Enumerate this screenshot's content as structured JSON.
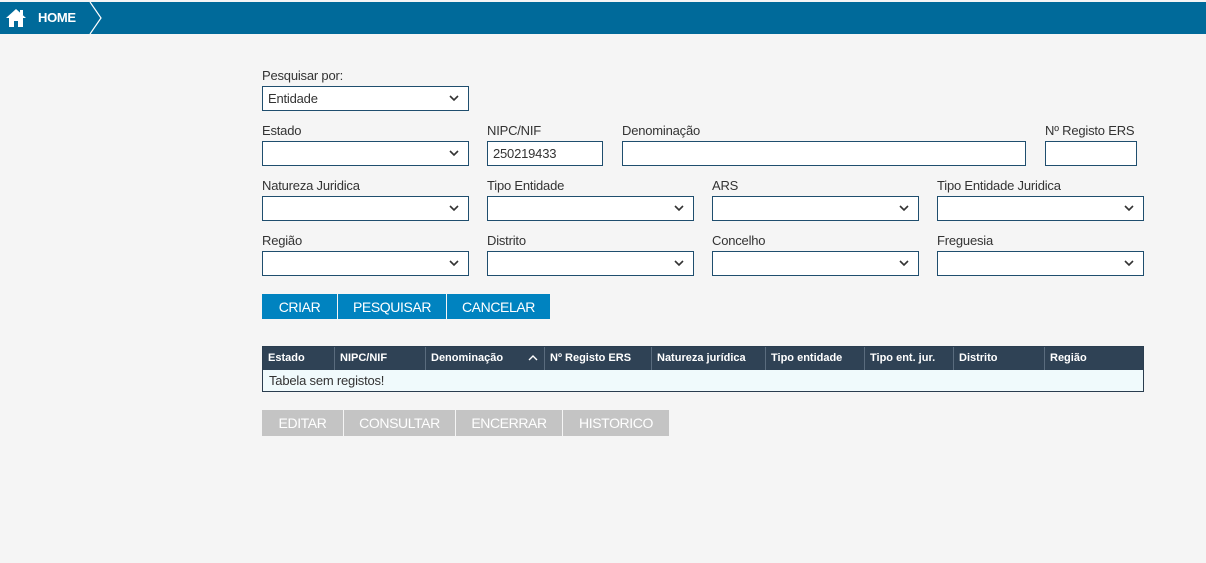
{
  "header": {
    "home_label": "HOME"
  },
  "search": {
    "label": "Pesquisar por:",
    "selected": "Entidade"
  },
  "fields": {
    "estado": {
      "label": "Estado",
      "value": ""
    },
    "nipc": {
      "label": "NIPC/NIF",
      "value": "250219433"
    },
    "denominacao": {
      "label": "Denominação",
      "value": ""
    },
    "registo_ers": {
      "label": "Nº Registo ERS",
      "value": ""
    },
    "natureza": {
      "label": "Natureza Juridica",
      "value": ""
    },
    "tipo_entidade": {
      "label": "Tipo Entidade",
      "value": ""
    },
    "ars": {
      "label": "ARS",
      "value": ""
    },
    "tipo_entidade_juridica": {
      "label": "Tipo Entidade Juridica",
      "value": ""
    },
    "regiao": {
      "label": "Região",
      "value": ""
    },
    "distrito": {
      "label": "Distrito",
      "value": ""
    },
    "concelho": {
      "label": "Concelho",
      "value": ""
    },
    "freguesia": {
      "label": "Freguesia",
      "value": ""
    }
  },
  "actions": {
    "criar": "CRIAR",
    "pesquisar": "PESQUISAR",
    "cancelar": "CANCELAR"
  },
  "table": {
    "columns": [
      "Estado",
      "NIPC/NIF",
      "Denominação",
      "Nº Registo ERS",
      "Natureza jurídica",
      "Tipo entidade",
      "Tipo ent. jur.",
      "Distrito",
      "Região"
    ],
    "empty_message": "Tabela sem registos!"
  },
  "row_actions": {
    "editar": "EDITAR",
    "consultar": "CONSULTAR",
    "encerrar": "ENCERRAR",
    "historico": "HISTORICO"
  },
  "colors": {
    "header_bar": "#006a9a",
    "primary_button": "#0083c0",
    "disabled_button": "#c4c4c4",
    "table_header": "#2f4255"
  },
  "icons": {
    "home": "home-icon",
    "dropdown": "chevron-down-icon",
    "sort": "chevron-up-icon"
  }
}
